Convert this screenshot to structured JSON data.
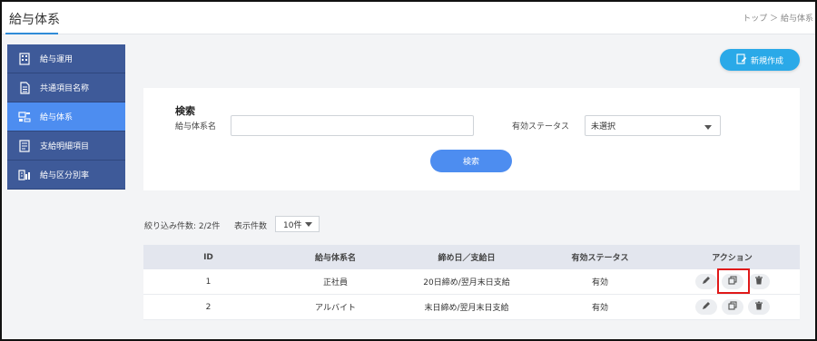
{
  "header": {
    "title": "給与体系",
    "breadcrumb": "トップ ＞ 給与体系"
  },
  "sidebar": {
    "items": [
      {
        "label": "給与運用",
        "icon": "building-icon",
        "active": false
      },
      {
        "label": "共通項目名称",
        "icon": "document-icon",
        "active": false
      },
      {
        "label": "給与体系",
        "icon": "structure-icon",
        "active": true
      },
      {
        "label": "支給明細項目",
        "icon": "list-icon",
        "active": false
      },
      {
        "label": "給与区分別率",
        "icon": "ratio-icon",
        "active": false
      }
    ]
  },
  "toolbar": {
    "new_label": "新規作成"
  },
  "search": {
    "title": "検索",
    "name_label": "給与体系名",
    "name_value": "",
    "status_label": "有効ステータス",
    "status_value": "未選択",
    "button_label": "検索"
  },
  "results": {
    "filter_count_text": "絞り込み件数: 2/2件",
    "display_label": "表示件数",
    "display_value": "10件"
  },
  "table": {
    "headers": [
      "ID",
      "給与体系名",
      "締め日／支給日",
      "有効ステータス",
      "アクション"
    ],
    "rows": [
      [
        "1",
        "正社員",
        "20日締め/翌月末日支給",
        "有効"
      ],
      [
        "2",
        "アルバイト",
        "末日締め/翌月末日支給",
        "有効"
      ]
    ]
  },
  "colors": {
    "sidebar_bg": "#3e5a99",
    "sidebar_active": "#4d8df0",
    "primary_button": "#4d8df0",
    "new_button": "#2aa9e8",
    "highlight_border": "#e01919"
  }
}
